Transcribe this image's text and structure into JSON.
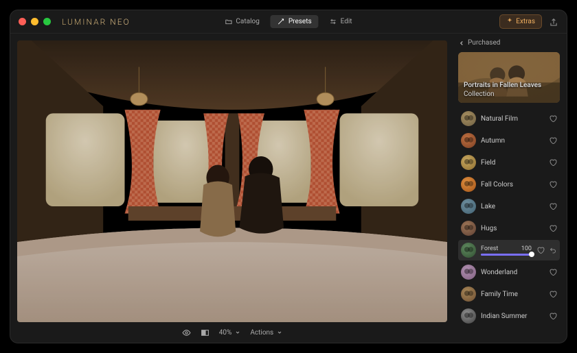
{
  "brand": "LUMINAR NEO",
  "nav": {
    "catalog": "Catalog",
    "presets": "Presets",
    "edit": "Edit"
  },
  "extras_label": "Extras",
  "sidebar": {
    "back_label": "Purchased",
    "collection": {
      "title": "Portraits in Fallen Leaves",
      "subtitle": "Collection"
    },
    "presets": [
      {
        "label": "Natural Film"
      },
      {
        "label": "Autumn"
      },
      {
        "label": "Field"
      },
      {
        "label": "Fall Colors"
      },
      {
        "label": "Lake"
      },
      {
        "label": "Hugs"
      },
      {
        "label": "Forest",
        "value": 100,
        "selected": true
      },
      {
        "label": "Wonderland"
      },
      {
        "label": "Family Time"
      },
      {
        "label": "Indian Summer"
      }
    ]
  },
  "bottombar": {
    "zoom": "40%",
    "actions": "Actions"
  },
  "colors": {
    "accent": "#7a6fff",
    "extras": "#f0b060"
  }
}
